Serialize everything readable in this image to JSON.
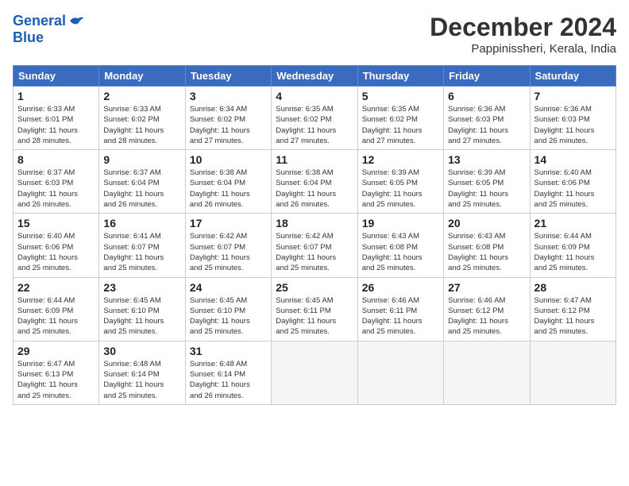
{
  "header": {
    "logo_line1": "General",
    "logo_line2": "Blue",
    "month": "December 2024",
    "location": "Pappinissheri, Kerala, India"
  },
  "days_of_week": [
    "Sunday",
    "Monday",
    "Tuesday",
    "Wednesday",
    "Thursday",
    "Friday",
    "Saturday"
  ],
  "weeks": [
    [
      {
        "day": "1",
        "info": "Sunrise: 6:33 AM\nSunset: 6:01 PM\nDaylight: 11 hours\nand 28 minutes."
      },
      {
        "day": "2",
        "info": "Sunrise: 6:33 AM\nSunset: 6:02 PM\nDaylight: 11 hours\nand 28 minutes."
      },
      {
        "day": "3",
        "info": "Sunrise: 6:34 AM\nSunset: 6:02 PM\nDaylight: 11 hours\nand 27 minutes."
      },
      {
        "day": "4",
        "info": "Sunrise: 6:35 AM\nSunset: 6:02 PM\nDaylight: 11 hours\nand 27 minutes."
      },
      {
        "day": "5",
        "info": "Sunrise: 6:35 AM\nSunset: 6:02 PM\nDaylight: 11 hours\nand 27 minutes."
      },
      {
        "day": "6",
        "info": "Sunrise: 6:36 AM\nSunset: 6:03 PM\nDaylight: 11 hours\nand 27 minutes."
      },
      {
        "day": "7",
        "info": "Sunrise: 6:36 AM\nSunset: 6:03 PM\nDaylight: 11 hours\nand 26 minutes."
      }
    ],
    [
      {
        "day": "8",
        "info": "Sunrise: 6:37 AM\nSunset: 6:03 PM\nDaylight: 11 hours\nand 26 minutes."
      },
      {
        "day": "9",
        "info": "Sunrise: 6:37 AM\nSunset: 6:04 PM\nDaylight: 11 hours\nand 26 minutes."
      },
      {
        "day": "10",
        "info": "Sunrise: 6:38 AM\nSunset: 6:04 PM\nDaylight: 11 hours\nand 26 minutes."
      },
      {
        "day": "11",
        "info": "Sunrise: 6:38 AM\nSunset: 6:04 PM\nDaylight: 11 hours\nand 26 minutes."
      },
      {
        "day": "12",
        "info": "Sunrise: 6:39 AM\nSunset: 6:05 PM\nDaylight: 11 hours\nand 25 minutes."
      },
      {
        "day": "13",
        "info": "Sunrise: 6:39 AM\nSunset: 6:05 PM\nDaylight: 11 hours\nand 25 minutes."
      },
      {
        "day": "14",
        "info": "Sunrise: 6:40 AM\nSunset: 6:06 PM\nDaylight: 11 hours\nand 25 minutes."
      }
    ],
    [
      {
        "day": "15",
        "info": "Sunrise: 6:40 AM\nSunset: 6:06 PM\nDaylight: 11 hours\nand 25 minutes."
      },
      {
        "day": "16",
        "info": "Sunrise: 6:41 AM\nSunset: 6:07 PM\nDaylight: 11 hours\nand 25 minutes."
      },
      {
        "day": "17",
        "info": "Sunrise: 6:42 AM\nSunset: 6:07 PM\nDaylight: 11 hours\nand 25 minutes."
      },
      {
        "day": "18",
        "info": "Sunrise: 6:42 AM\nSunset: 6:07 PM\nDaylight: 11 hours\nand 25 minutes."
      },
      {
        "day": "19",
        "info": "Sunrise: 6:43 AM\nSunset: 6:08 PM\nDaylight: 11 hours\nand 25 minutes."
      },
      {
        "day": "20",
        "info": "Sunrise: 6:43 AM\nSunset: 6:08 PM\nDaylight: 11 hours\nand 25 minutes."
      },
      {
        "day": "21",
        "info": "Sunrise: 6:44 AM\nSunset: 6:09 PM\nDaylight: 11 hours\nand 25 minutes."
      }
    ],
    [
      {
        "day": "22",
        "info": "Sunrise: 6:44 AM\nSunset: 6:09 PM\nDaylight: 11 hours\nand 25 minutes."
      },
      {
        "day": "23",
        "info": "Sunrise: 6:45 AM\nSunset: 6:10 PM\nDaylight: 11 hours\nand 25 minutes."
      },
      {
        "day": "24",
        "info": "Sunrise: 6:45 AM\nSunset: 6:10 PM\nDaylight: 11 hours\nand 25 minutes."
      },
      {
        "day": "25",
        "info": "Sunrise: 6:45 AM\nSunset: 6:11 PM\nDaylight: 11 hours\nand 25 minutes."
      },
      {
        "day": "26",
        "info": "Sunrise: 6:46 AM\nSunset: 6:11 PM\nDaylight: 11 hours\nand 25 minutes."
      },
      {
        "day": "27",
        "info": "Sunrise: 6:46 AM\nSunset: 6:12 PM\nDaylight: 11 hours\nand 25 minutes."
      },
      {
        "day": "28",
        "info": "Sunrise: 6:47 AM\nSunset: 6:12 PM\nDaylight: 11 hours\nand 25 minutes."
      }
    ],
    [
      {
        "day": "29",
        "info": "Sunrise: 6:47 AM\nSunset: 6:13 PM\nDaylight: 11 hours\nand 25 minutes."
      },
      {
        "day": "30",
        "info": "Sunrise: 6:48 AM\nSunset: 6:14 PM\nDaylight: 11 hours\nand 25 minutes."
      },
      {
        "day": "31",
        "info": "Sunrise: 6:48 AM\nSunset: 6:14 PM\nDaylight: 11 hours\nand 26 minutes."
      },
      {
        "day": "",
        "info": ""
      },
      {
        "day": "",
        "info": ""
      },
      {
        "day": "",
        "info": ""
      },
      {
        "day": "",
        "info": ""
      }
    ]
  ]
}
